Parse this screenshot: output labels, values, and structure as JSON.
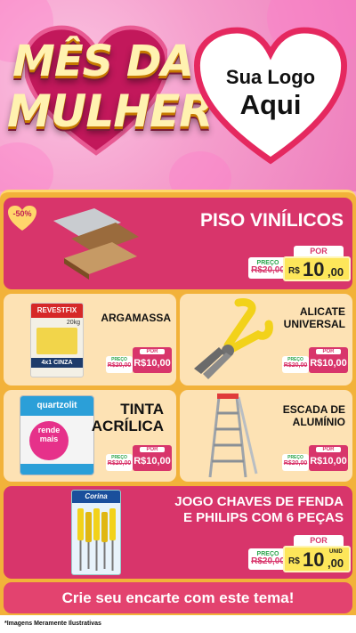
{
  "header": {
    "title_line1": "MÊS DA",
    "title_line2": "MULHER",
    "logo_line1": "Sua Logo",
    "logo_line2": "Aqui"
  },
  "colors": {
    "pink": "#d8356b",
    "cream": "#fde2b4",
    "yellow": "#f2b23a",
    "green": "#2aa44b"
  },
  "products": [
    {
      "name": "PISO VINÍLICOS",
      "discount": "-50%",
      "price_label": "PREÇO",
      "old_price": "R$20,00",
      "por_label": "POR",
      "currency": "R$",
      "price_int": "10",
      "price_dec": ",00",
      "icon": "vinyl-floor-icon"
    },
    {
      "name": "ARGAMASSA",
      "price_label": "PREÇO",
      "old_price": "R$20,00",
      "por_label": "POR",
      "new_price": "R$10,00",
      "package_brand": "REVESTFIX",
      "package_weight": "20kg",
      "package_type": "4x1 CINZA",
      "icon": "mortar-bag-icon"
    },
    {
      "name_line1": "ALICATE",
      "name_line2": "UNIVERSAL",
      "price_label": "PREÇO",
      "old_price": "R$20,00",
      "por_label": "POR",
      "new_price": "R$10,00",
      "icon": "pliers-icon"
    },
    {
      "name_line1": "TINTA",
      "name_line2": "ACRÍLICA",
      "price_label": "PREÇO",
      "old_price": "R$20,00",
      "por_label": "POR",
      "new_price": "R$10,00",
      "package_brand": "quartzolit",
      "package_line1": "rende",
      "package_line2": "mais",
      "icon": "paint-can-icon"
    },
    {
      "name_line1": "ESCADA DE",
      "name_line2": "ALUMÍNIO",
      "price_label": "PREÇO",
      "old_price": "R$20,00",
      "por_label": "POR",
      "new_price": "R$10,00",
      "icon": "ladder-icon"
    },
    {
      "name_line1": "JOGO CHAVES DE FENDA",
      "name_line2": "E PHILIPS COM 6 PEÇAS",
      "price_label": "PREÇO",
      "old_price": "R$20,00",
      "por_label": "POR",
      "currency": "R$",
      "price_int": "10",
      "price_dec": ",00",
      "unit": "UNID",
      "package_brand": "Corina",
      "icon": "screwdriver-set-icon"
    }
  ],
  "footer": {
    "cta": "Crie seu encarte com este tema!",
    "disclaimer": "*Imagens Meramente Ilustrativas"
  }
}
